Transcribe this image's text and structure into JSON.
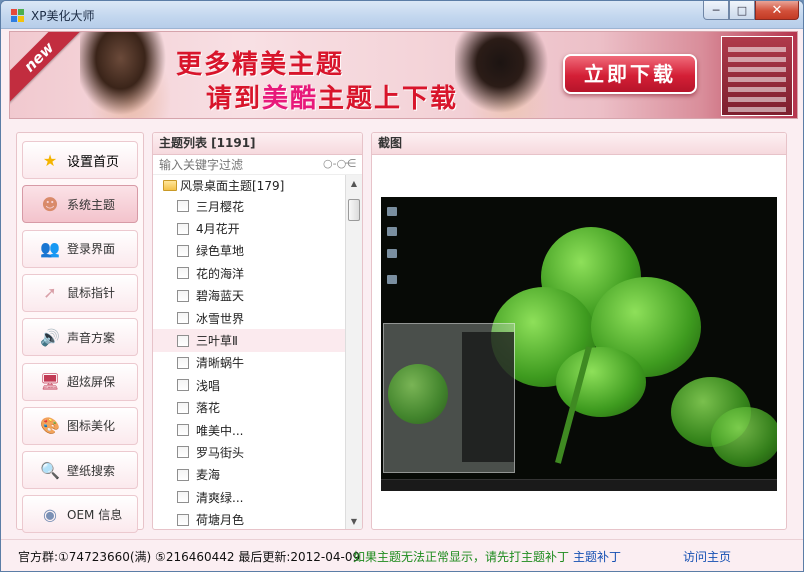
{
  "window": {
    "title": "XP美化大师",
    "controls": {
      "minimize": "─",
      "maximize": "□",
      "close": "✕"
    }
  },
  "banner": {
    "ribbon": "new",
    "line1": "更多精美主题",
    "line2_pre": "请到",
    "line2_hl": "美酷",
    "line2_post": "主题上下载",
    "button": "立即下载"
  },
  "nav": {
    "items": [
      {
        "label": "设置首页",
        "icon": "star-icon",
        "glyph": "★",
        "color": "#f4b400"
      },
      {
        "label": "系统主题",
        "icon": "monkey-icon",
        "glyph": "☻",
        "color": "#d98a6a"
      },
      {
        "label": "登录界面",
        "icon": "users-icon",
        "glyph": "👥",
        "color": "#b97d5b"
      },
      {
        "label": "鼠标指针",
        "icon": "cursor-icon",
        "glyph": "➚",
        "color": "#d9a0a8"
      },
      {
        "label": "声音方案",
        "icon": "speaker-icon",
        "glyph": "🔊",
        "color": "#c58c95"
      },
      {
        "label": "超炫屏保",
        "icon": "monitor-icon",
        "glyph": "🖥",
        "color": "#c23a54"
      },
      {
        "label": "图标美化",
        "icon": "palette-icon",
        "glyph": "🎨",
        "color": "#e0883a"
      },
      {
        "label": "壁纸搜索",
        "icon": "magnifier-icon",
        "glyph": "🔍",
        "color": "#8a7ea3"
      },
      {
        "label": "OEM 信息",
        "icon": "globe-icon",
        "glyph": "◉",
        "color": "#7a90b5"
      }
    ]
  },
  "theme_list": {
    "header": "主题列表 [1191]",
    "filter_placeholder": "输入关键字过滤",
    "folder": "风景桌面主题[179]",
    "items": [
      {
        "label": "三月樱花",
        "selected": false
      },
      {
        "label": "4月花开",
        "selected": false
      },
      {
        "label": "绿色草地",
        "selected": false
      },
      {
        "label": "花的海洋",
        "selected": false
      },
      {
        "label": "碧海蓝天",
        "selected": false
      },
      {
        "label": "冰雪世界",
        "selected": false
      },
      {
        "label": "三叶草Ⅱ",
        "selected": true
      },
      {
        "label": "清晰蜗牛",
        "selected": false
      },
      {
        "label": "浅唱",
        "selected": false
      },
      {
        "label": "落花",
        "selected": false
      },
      {
        "label": "唯美中...",
        "selected": false
      },
      {
        "label": "罗马街头",
        "selected": false
      },
      {
        "label": "麦海",
        "selected": false
      },
      {
        "label": "清爽绿...",
        "selected": false
      },
      {
        "label": "荷塘月色",
        "selected": false
      }
    ]
  },
  "preview": {
    "header": "截图"
  },
  "status": {
    "info": "官方群:①74723660(满) ⑤216460442 最后更新:2012-04-09",
    "warning": "如果主题无法正常显示，请先打主题补丁",
    "patch_link": "主题补丁",
    "home_link": "访问主页"
  }
}
